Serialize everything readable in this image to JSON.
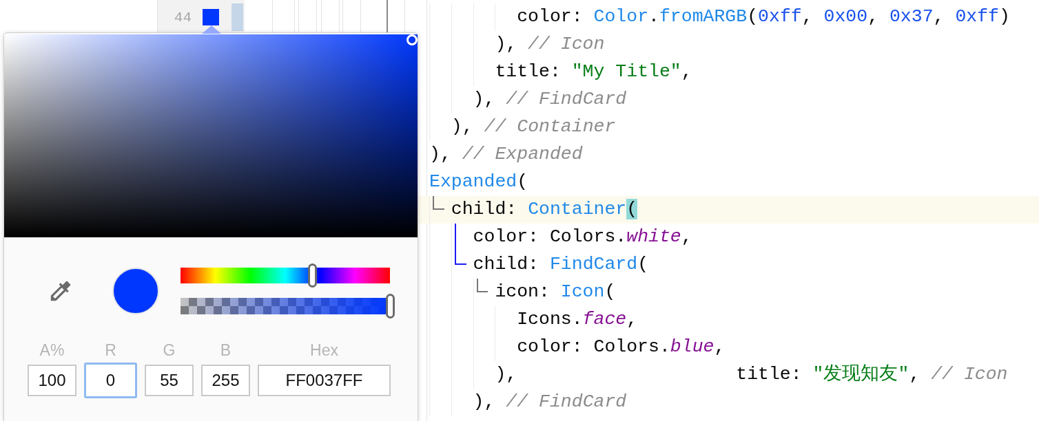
{
  "gutter": {
    "line_number": "44",
    "color_swatch": true,
    "changed": true
  },
  "code": {
    "lines": [
      {
        "children": [
          {
            "children": [
              {
                "children": [
                  {
                    "children": [
                      {
                        "current": false,
                        "tokens": [
                          {
                            "kind": "plain",
                            "text": "color: "
                          },
                          {
                            "kind": "type",
                            "text": "Color"
                          },
                          {
                            "kind": "plain",
                            "text": "."
                          },
                          {
                            "kind": "type",
                            "text": "fromARGB"
                          },
                          {
                            "kind": "plain",
                            "text": "("
                          },
                          {
                            "kind": "number",
                            "text": "0xff"
                          },
                          {
                            "kind": "plain",
                            "text": ", "
                          },
                          {
                            "kind": "number",
                            "text": "0x00"
                          },
                          {
                            "kind": "plain",
                            "text": ", "
                          },
                          {
                            "kind": "number",
                            "text": "0x37"
                          },
                          {
                            "kind": "plain",
                            "text": ", "
                          },
                          {
                            "kind": "number",
                            "text": "0xff"
                          },
                          {
                            "kind": "plain",
                            "text": ")"
                          }
                        ]
                      }
                    ]
                  },
                  {
                    "current": false,
                    "tokens": [
                      {
                        "kind": "plain",
                        "text": "), "
                      },
                      {
                        "kind": "comment",
                        "text": "// Icon"
                      }
                    ]
                  },
                  {
                    "current": false,
                    "tokens": [
                      {
                        "kind": "plain",
                        "text": "title: "
                      },
                      {
                        "kind": "string",
                        "text": "\"My Title\""
                      },
                      {
                        "kind": "plain",
                        "text": ","
                      }
                    ]
                  }
                ]
              },
              {
                "current": false,
                "tokens": [
                  {
                    "kind": "plain",
                    "text": "), "
                  },
                  {
                    "kind": "comment",
                    "text": "// FindCard"
                  }
                ]
              }
            ]
          },
          {
            "current": false,
            "tokens": [
              {
                "kind": "plain",
                "text": "), "
              },
              {
                "kind": "comment",
                "text": "// Container"
              }
            ]
          }
        ]
      },
      {
        "current": false,
        "tokens": [
          {
            "kind": "plain",
            "text": "), "
          },
          {
            "kind": "comment",
            "text": "// Expanded"
          }
        ]
      },
      {
        "current": false,
        "tokens": [
          {
            "kind": "type",
            "text": "Expanded"
          },
          {
            "kind": "plain",
            "text": "("
          }
        ],
        "children": [
          {
            "current": true,
            "tokens": [
              {
                "kind": "plain",
                "text": "child: "
              },
              {
                "kind": "type",
                "text": "Container"
              },
              {
                "kind": "match",
                "text": "("
              }
            ],
            "children": [
              {
                "current": false,
                "tokens": [
                  {
                    "kind": "plain",
                    "text": "color: Colors."
                  },
                  {
                    "kind": "field",
                    "text": "white"
                  },
                  {
                    "kind": "plain",
                    "text": ","
                  }
                ]
              },
              {
                "current": false,
                "tokens": [
                  {
                    "kind": "plain",
                    "text": "child: "
                  },
                  {
                    "kind": "type",
                    "text": "FindCard"
                  },
                  {
                    "kind": "plain",
                    "text": "("
                  }
                ],
                "children": [
                  {
                    "current": false,
                    "tokens": [
                      {
                        "kind": "plain",
                        "text": "icon: "
                      },
                      {
                        "kind": "type",
                        "text": "Icon"
                      },
                      {
                        "kind": "plain",
                        "text": "("
                      }
                    ],
                    "children": [
                      {
                        "current": false,
                        "tokens": [
                          {
                            "kind": "plain",
                            "text": "Icons."
                          },
                          {
                            "kind": "field",
                            "text": "face"
                          },
                          {
                            "kind": "plain",
                            "text": ","
                          }
                        ]
                      },
                      {
                        "current": false,
                        "tokens": [
                          {
                            "kind": "plain",
                            "text": "color: Colors."
                          },
                          {
                            "kind": "field",
                            "text": "blue"
                          },
                          {
                            "kind": "plain",
                            "text": ","
                          }
                        ]
                      }
                    ]
                  },
                  {
                    "current": false,
                    "tokens": [
                      {
                        "kind": "plain",
                        "text": "),"
                      }
                    ],
                    "trailing": [
                      {
                        "kind": "plain",
                        "text": "title: "
                      },
                      {
                        "kind": "string",
                        "text": "\"发现知友\""
                      },
                      {
                        "kind": "plain",
                        "text": ", "
                      },
                      {
                        "kind": "comment",
                        "text": "// Icon"
                      }
                    ]
                  }
                ]
              },
              {
                "current": false,
                "tokens": [
                  {
                    "kind": "plain",
                    "text": "), "
                  },
                  {
                    "kind": "comment",
                    "text": "// FindCard"
                  }
                ]
              }
            ]
          }
        ]
      }
    ]
  },
  "color_picker": {
    "hue": {
      "level": 0.63
    },
    "alpha": {
      "level": 1
    },
    "fields": [
      {
        "kind": "channel",
        "label": "A%",
        "value": "100",
        "focused": false
      },
      {
        "kind": "channel",
        "label": "R",
        "value": "0",
        "focused": true
      },
      {
        "kind": "channel",
        "label": "G",
        "value": "55",
        "focused": false
      },
      {
        "kind": "channel",
        "label": "B",
        "value": "255",
        "focused": false
      },
      {
        "kind": "hex",
        "label": "Hex",
        "value": "FF0037FF",
        "focused": false
      }
    ]
  }
}
